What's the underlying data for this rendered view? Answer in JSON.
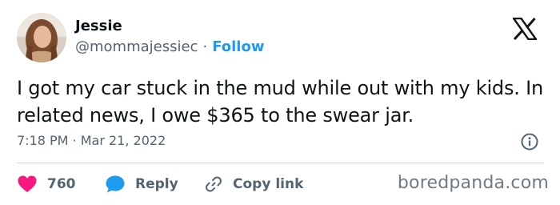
{
  "user": {
    "display_name": "Jessie",
    "handle": "@mommajessiec",
    "separator": "·",
    "follow_label": "Follow"
  },
  "tweet": {
    "text": "I got my car stuck in the mud while out with my kids. In related news, I owe $365 to the swear jar.",
    "timestamp": "7:18 PM · Mar 21, 2022"
  },
  "actions": {
    "like_count": "760",
    "reply_label": "Reply",
    "copy_link_label": "Copy link"
  },
  "watermark": "boredpanda.com",
  "colors": {
    "text": "#0f1419",
    "secondary": "#536471",
    "accent_blue": "#1d9bf0",
    "like_red": "#f91880",
    "divider": "#cfd9de"
  },
  "icons": [
    "x-logo-icon",
    "info-icon",
    "heart-icon",
    "reply-bubble-icon",
    "link-icon"
  ]
}
